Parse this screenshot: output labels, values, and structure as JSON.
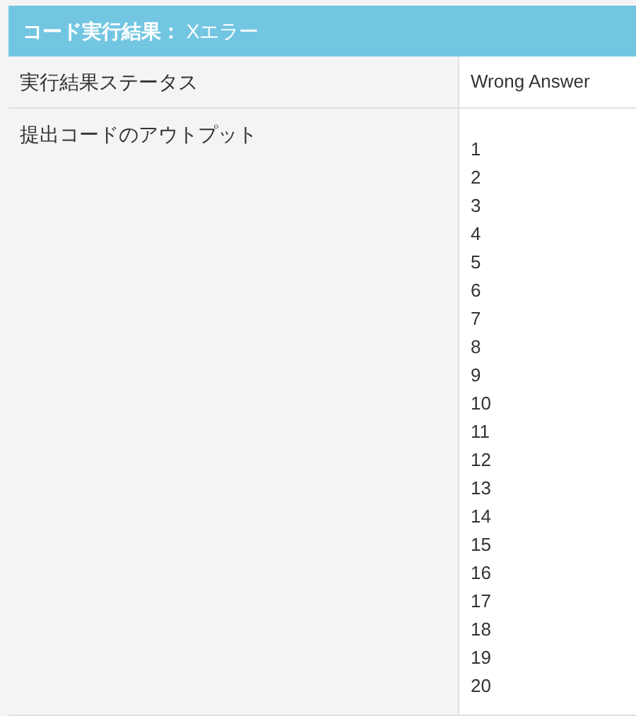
{
  "header": {
    "title": "**コード実行結果：** Xエラー"
  },
  "rows": [
    {
      "kind": "text",
      "label": "実行結果ステータス",
      "value": "Wrong Answer"
    },
    {
      "kind": "lines",
      "label": "提出コードのアウトプット",
      "lines": [
        "1",
        "2",
        "3",
        "4",
        "5",
        "6",
        "7",
        "8",
        "9",
        "10",
        "11",
        "12",
        "13",
        "14",
        "15",
        "16",
        "17",
        "18",
        "19",
        "20"
      ]
    }
  ]
}
